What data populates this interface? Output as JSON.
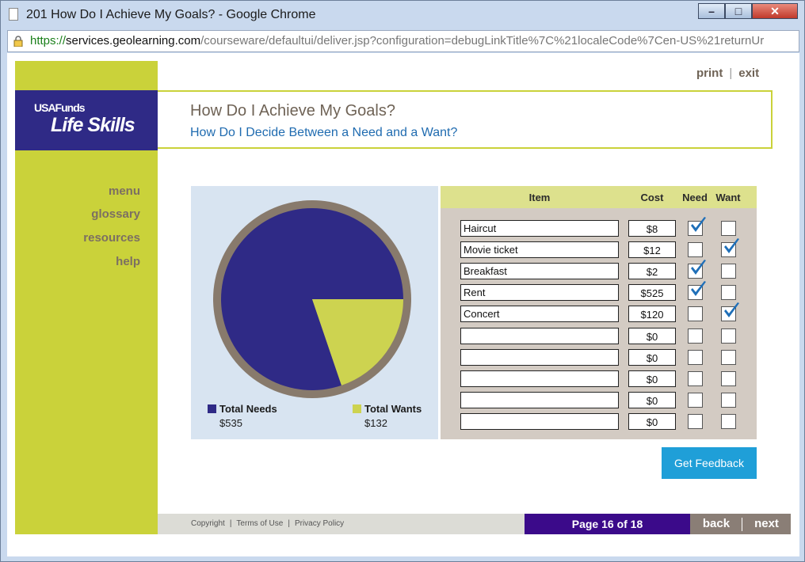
{
  "window": {
    "title": "201 How Do I Achieve My Goals? - Google Chrome",
    "url_scheme": "https://",
    "url_host": "services.geolearning.com",
    "url_path": "/courseware/defaultui/deliver.jsp?configuration=debugLinkTitle%7C%21localeCode%7Cen-US%21returnUr"
  },
  "logo": {
    "line1": "USAFunds",
    "line2": "Life Skills"
  },
  "top_links": {
    "print": "print",
    "exit": "exit"
  },
  "header": {
    "title": "How Do I Achieve My Goals?",
    "subtitle": "How Do I Decide Between a Need and a Want?"
  },
  "nav": {
    "menu": "menu",
    "glossary": "glossary",
    "resources": "resources",
    "help": "help"
  },
  "chart_data": {
    "type": "pie",
    "categories": [
      "Total Needs",
      "Total Wants"
    ],
    "values": [
      535,
      132
    ],
    "value_labels": [
      "$535",
      "$132"
    ],
    "colors": [
      "#2f2a86",
      "#cdd350"
    ],
    "ring_color": "#887a6c"
  },
  "table": {
    "headers": {
      "item": "Item",
      "cost": "Cost",
      "need": "Need",
      "want": "Want"
    },
    "rows": [
      {
        "item": "Haircut",
        "cost": "$8",
        "need": true,
        "want": false
      },
      {
        "item": "Movie ticket",
        "cost": "$12",
        "need": false,
        "want": true
      },
      {
        "item": "Breakfast",
        "cost": "$2",
        "need": true,
        "want": false
      },
      {
        "item": "Rent",
        "cost": "$525",
        "need": true,
        "want": false
      },
      {
        "item": "Concert",
        "cost": "$120",
        "need": false,
        "want": true
      },
      {
        "item": "",
        "cost": "$0",
        "need": false,
        "want": false
      },
      {
        "item": "",
        "cost": "$0",
        "need": false,
        "want": false
      },
      {
        "item": "",
        "cost": "$0",
        "need": false,
        "want": false
      },
      {
        "item": "",
        "cost": "$0",
        "need": false,
        "want": false
      },
      {
        "item": "",
        "cost": "$0",
        "need": false,
        "want": false
      }
    ]
  },
  "feedback_label": "Get Feedback",
  "footer": {
    "copyright": "Copyright",
    "terms": "Terms of Use",
    "privacy": "Privacy Policy"
  },
  "pagination": {
    "indicator": "Page 16 of 18",
    "back": "back",
    "next": "next"
  },
  "colors": {
    "accent_green": "#cad23a",
    "navy": "#2f2a86",
    "feedback_blue": "#1f9fd8",
    "page_purple": "#3b0a8a"
  }
}
